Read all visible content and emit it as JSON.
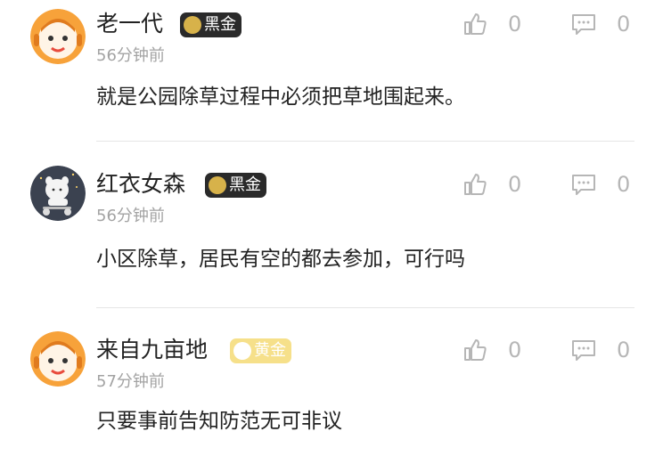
{
  "comments": [
    {
      "username": "老一代",
      "badge": "黑金",
      "badge_style": "black",
      "avatar": "cartoon-face-avatar",
      "time": "56分钟前",
      "text": "就是公园除草过程中必须把草地围起来。",
      "likes": "0",
      "replies": "0"
    },
    {
      "username": "红衣女森",
      "badge": "黑金",
      "badge_style": "black",
      "avatar": "cartoon-animal-avatar",
      "time": "56分钟前",
      "text": "小区除草，居民有空的都去参加，可行吗",
      "likes": "0",
      "replies": "0"
    },
    {
      "username": "来自九亩地",
      "badge": "黄金",
      "badge_style": "gold",
      "avatar": "cartoon-face-avatar",
      "time": "57分钟前",
      "text": "只要事前告知防范无可非议",
      "likes": "0",
      "replies": "0"
    }
  ],
  "icons": {
    "like": "thumbs-up-icon",
    "comment": "comment-bubble-icon"
  },
  "colors": {
    "black_badge": "#2a2a2a",
    "gold_badge": "#f6e08a",
    "avatar_orange": "#f7a23a",
    "secondary_text": "#a3a3a3"
  }
}
